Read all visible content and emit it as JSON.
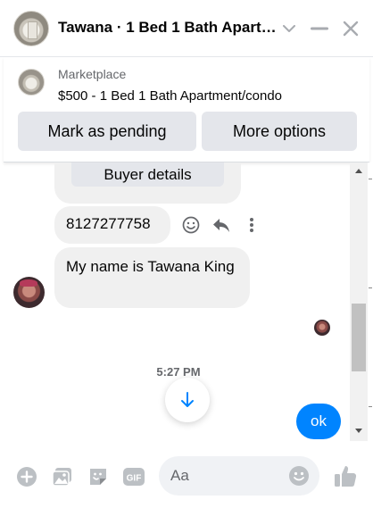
{
  "header": {
    "title": "Tawana · 1 Bed 1 Bath Apartment/condo",
    "icons": [
      "chevron-down-icon",
      "minimize-icon",
      "close-icon"
    ]
  },
  "marketplace": {
    "label": "Marketplace",
    "listing_title": "$500 - 1 Bed 1 Bath Apartment/condo",
    "buttons": {
      "pending": "Mark as pending",
      "more": "More options"
    }
  },
  "conversation": {
    "buyer_details_label": "Buyer details",
    "messages": [
      {
        "from": "Tawana",
        "text": "8127277758"
      },
      {
        "from": "Tawana",
        "text": "My name is Tawana King"
      },
      {
        "from": "me",
        "text": "ok"
      }
    ],
    "timestamp": "5:27 PM"
  },
  "composer": {
    "placeholder": "Aa"
  },
  "colors": {
    "accent": "#0084ff",
    "bubble_incoming": "#f0f0f0",
    "button_bg": "#e4e6eb",
    "muted_text": "#65676b"
  }
}
